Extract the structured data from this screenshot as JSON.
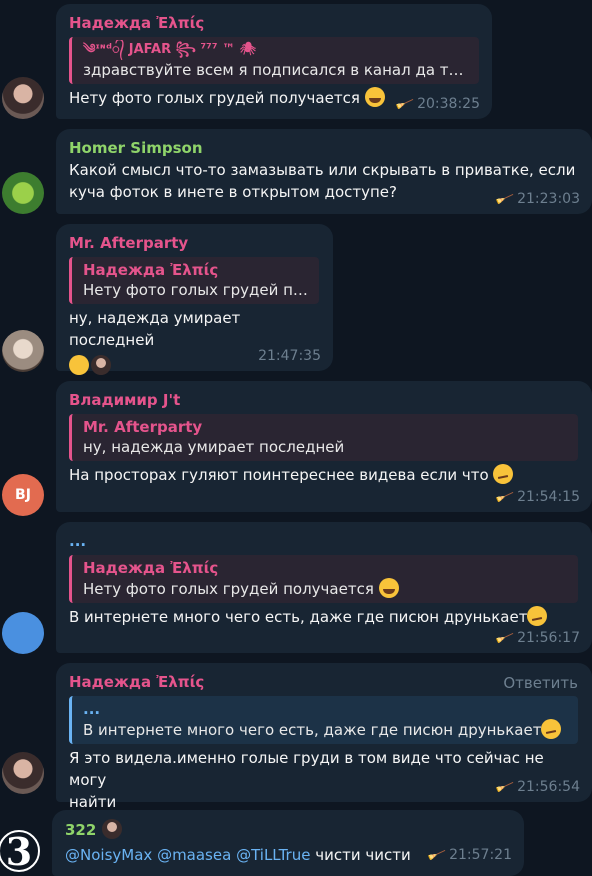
{
  "messages": [
    {
      "sender": "Надежда Ἐλπίς",
      "reply": {
        "name": "༄ᶦᶰᵈ᭄ JAFAR ꧂ ⁷⁷⁷ ™ 🕷",
        "text": "здравствуйте всем я подписался в канал да там ..."
      },
      "text": "Нету фото голых грудей получается",
      "time": "20:38:25"
    },
    {
      "sender": "Homer Simpson",
      "text_line1": "Какой смысл что-то замазывать или скрывать в приватке, если",
      "text_line2": "куча фоток в инете в открытом доступе?",
      "time": "21:23:03"
    },
    {
      "sender": "Mr. Afterparty",
      "reply": {
        "name": "Надежда Ἐλπίς",
        "text": "Нету фото голых грудей по..."
      },
      "text": "ну, надежда умирает последней",
      "time": "21:47:35"
    },
    {
      "sender": "Владимир J't",
      "reply": {
        "name": "Mr. Afterparty",
        "text": "ну, надежда умирает последней"
      },
      "text": "На просторах гуляют поинтереснее видева если что",
      "time": "21:54:15",
      "avatar": "BJ"
    },
    {
      "sender": "...",
      "reply": {
        "name": "Надежда Ἐλπίς",
        "text": "Нету фото голых грудей получается"
      },
      "text": "В интернете много чего есть, даже где писюн друнькает",
      "time": "21:56:17"
    },
    {
      "sender": "Надежда Ἐλπίς",
      "reply_button": "Ответить",
      "reply": {
        "name": "...",
        "text": "В интернете много чего есть, даже где писюн друнькает"
      },
      "text_line1": "Я это видела.именно голые груди в том виде что сейчас не могу",
      "text_line2": "найти",
      "time": "21:56:54"
    },
    {
      "sender": "322",
      "mentions": [
        "@NoisyMax",
        "@maasea",
        "@TiLLTrue"
      ],
      "text": "чисти чисти",
      "time": "21:57:21",
      "avatar": "3"
    }
  ],
  "icons": {
    "broom": "broom-icon"
  }
}
